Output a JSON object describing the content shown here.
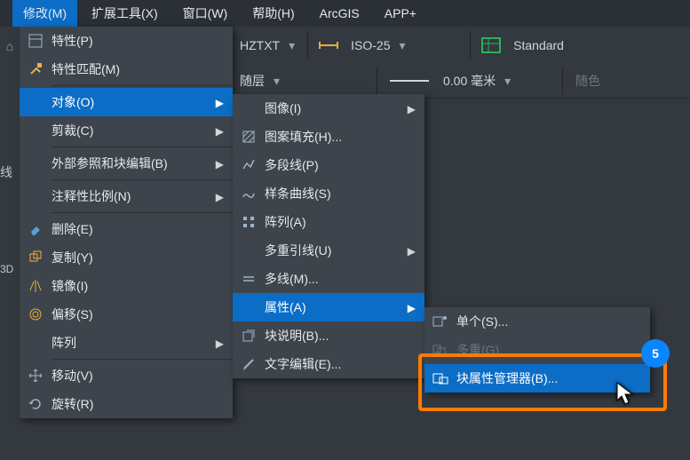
{
  "menubar": {
    "modify": "修改(M)",
    "ext": "扩展工具(X)",
    "window": "窗口(W)",
    "help": "帮助(H)",
    "arcgis": "ArcGIS",
    "appplus": "APP+"
  },
  "toolbar1": {
    "style_value": "HZTXT",
    "dim_value": "ISO-25",
    "std_value": "Standard"
  },
  "toolbar2": {
    "layer_value": "随层",
    "lw_value": "0.00 毫米",
    "color_value": "随色"
  },
  "side": {
    "line": "线",
    "tag": "3D"
  },
  "menu_modify": {
    "properties": "特性(P)",
    "match": "特性匹配(M)",
    "object": "对象(O)",
    "clip": "剪裁(C)",
    "xref": "外部参照和块编辑(B)",
    "annoscale": "注释性比例(N)",
    "erase": "删除(E)",
    "copy": "复制(Y)",
    "mirror": "镜像(I)",
    "offset": "偏移(S)",
    "array": "阵列",
    "move": "移动(V)",
    "rotate": "旋转(R)"
  },
  "menu_object": {
    "image": "图像(I)",
    "hatch": "图案填充(H)...",
    "pline": "多段线(P)",
    "spline": "样条曲线(S)",
    "arraysub": "阵列(A)",
    "mleader": "多重引线(U)",
    "mline": "多线(M)...",
    "attribute": "属性(A)",
    "blockdesc": "块说明(B)...",
    "textedit": "文字编辑(E)..."
  },
  "menu_attr": {
    "single": "单个(S)...",
    "multi": "多重(G)",
    "battman": "块属性管理器(B)..."
  },
  "badge": "5"
}
